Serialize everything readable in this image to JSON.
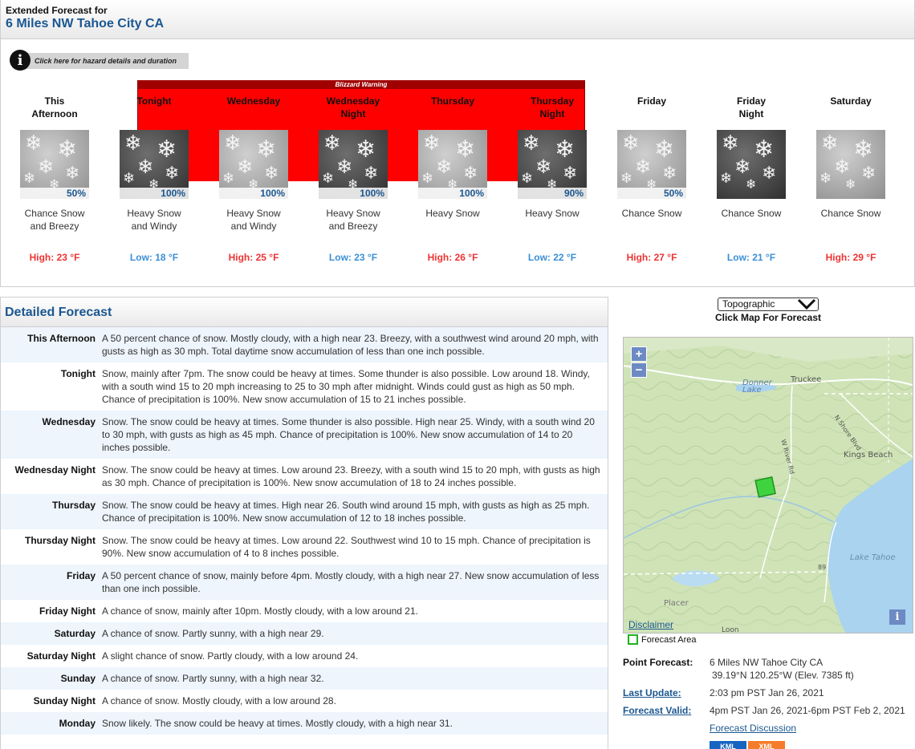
{
  "extended": {
    "title_line1": "Extended Forecast for",
    "title_line2": "6 Miles NW Tahoe City CA",
    "hazard_link": "Click here for hazard details and duration",
    "warning_label": "Blizzard Warning",
    "periods": [
      {
        "name": "This\nAfternoon",
        "pop": "50%",
        "desc": "Chance Snow\nand Breezy",
        "temp": "High: 23 °F",
        "kind": "high",
        "icon": "snow-light-icon"
      },
      {
        "name": "Tonight",
        "pop": "100%",
        "desc": "Heavy Snow\nand Windy",
        "temp": "Low: 18 °F",
        "kind": "low",
        "icon": "snow-dark-icon"
      },
      {
        "name": "Wednesday",
        "pop": "100%",
        "desc": "Heavy Snow\nand Windy",
        "temp": "High: 25 °F",
        "kind": "high",
        "icon": "snow-light-icon"
      },
      {
        "name": "Wednesday\nNight",
        "pop": "100%",
        "desc": "Heavy Snow\nand Breezy",
        "temp": "Low: 23 °F",
        "kind": "low",
        "icon": "snow-dark-icon"
      },
      {
        "name": "Thursday",
        "pop": "100%",
        "desc": "Heavy Snow",
        "temp": "High: 26 °F",
        "kind": "high",
        "icon": "snow-light-icon"
      },
      {
        "name": "Thursday\nNight",
        "pop": "90%",
        "desc": "Heavy Snow",
        "temp": "Low: 22 °F",
        "kind": "low",
        "icon": "snow-dark-icon"
      },
      {
        "name": "Friday",
        "pop": "50%",
        "desc": "Chance Snow",
        "temp": "High: 27 °F",
        "kind": "high",
        "icon": "snow-light-icon"
      },
      {
        "name": "Friday\nNight",
        "pop": "",
        "desc": "Chance Snow",
        "temp": "Low: 21 °F",
        "kind": "low",
        "icon": "snow-dark-icon"
      },
      {
        "name": "Saturday",
        "pop": "",
        "desc": "Chance Snow",
        "temp": "High: 29 °F",
        "kind": "high",
        "icon": "snow-light-icon"
      }
    ]
  },
  "detailed": {
    "title": "Detailed Forecast",
    "rows": [
      {
        "label": "This Afternoon",
        "text": "A 50 percent chance of snow. Mostly cloudy, with a high near 23. Breezy, with a southwest wind around 20 mph, with gusts as high as 30 mph. Total daytime snow accumulation of less than one inch possible."
      },
      {
        "label": "Tonight",
        "text": "Snow, mainly after 7pm. The snow could be heavy at times. Some thunder is also possible. Low around 18. Windy, with a south wind 15 to 20 mph increasing to 25 to 30 mph after midnight. Winds could gust as high as 50 mph. Chance of precipitation is 100%. New snow accumulation of 15 to 21 inches possible."
      },
      {
        "label": "Wednesday",
        "text": "Snow. The snow could be heavy at times. Some thunder is also possible. High near 25. Windy, with a south wind 20 to 30 mph, with gusts as high as 45 mph. Chance of precipitation is 100%. New snow accumulation of 14 to 20 inches possible."
      },
      {
        "label": "Wednesday Night",
        "text": "Snow. The snow could be heavy at times. Low around 23. Breezy, with a south wind 15 to 20 mph, with gusts as high as 30 mph. Chance of precipitation is 100%. New snow accumulation of 18 to 24 inches possible."
      },
      {
        "label": "Thursday",
        "text": "Snow. The snow could be heavy at times. High near 26. South wind around 15 mph, with gusts as high as 25 mph. Chance of precipitation is 100%. New snow accumulation of 12 to 18 inches possible."
      },
      {
        "label": "Thursday Night",
        "text": "Snow. The snow could be heavy at times. Low around 22. Southwest wind 10 to 15 mph. Chance of precipitation is 90%. New snow accumulation of 4 to 8 inches possible."
      },
      {
        "label": "Friday",
        "text": "A 50 percent chance of snow, mainly before 4pm. Mostly cloudy, with a high near 27. New snow accumulation of less than one inch possible."
      },
      {
        "label": "Friday Night",
        "text": "A chance of snow, mainly after 10pm. Mostly cloudy, with a low around 21."
      },
      {
        "label": "Saturday",
        "text": "A chance of snow. Partly sunny, with a high near 29."
      },
      {
        "label": "Saturday Night",
        "text": "A slight chance of snow. Partly cloudy, with a low around 24."
      },
      {
        "label": "Sunday",
        "text": "A chance of snow. Partly sunny, with a high near 32."
      },
      {
        "label": "Sunday Night",
        "text": "A chance of snow. Mostly cloudy, with a low around 28."
      },
      {
        "label": "Monday",
        "text": "Snow likely. The snow could be heavy at times. Mostly cloudy, with a high near 31."
      }
    ]
  },
  "map": {
    "select_value": "Topographic",
    "click_label": "Click Map For Forecast",
    "zoom_in": "+",
    "zoom_out": "−",
    "info": "i",
    "disclaimer": "Disclaimer",
    "legend": "Forecast Area",
    "places": {
      "donner": "Donner\nLake",
      "truckee": "Truckee",
      "shore": "N Shore Blvd",
      "kings": "Kings Beach",
      "river": "W River Rd",
      "lake": "Lake Tahoe",
      "placer": "Placer",
      "rt89": "89",
      "bottom": "Loon"
    },
    "colors": {
      "terrain": "#cfe3b7",
      "water": "#a9d3ef",
      "area": "#3fd33f"
    }
  },
  "point": {
    "point_label": "Point Forecast:",
    "point_value1": "6 Miles NW Tahoe City CA",
    "point_value2": "39.19°N 120.25°W (Elev. 7385 ft)",
    "update_label": "Last Update:",
    "update_value": "2:03 pm PST Jan 26, 2021",
    "valid_label": "Forecast Valid:",
    "valid_value": "4pm PST Jan 26, 2021-6pm PST Feb 2, 2021",
    "discussion": "Forecast Discussion",
    "kml": "KML",
    "xml": "XML"
  }
}
